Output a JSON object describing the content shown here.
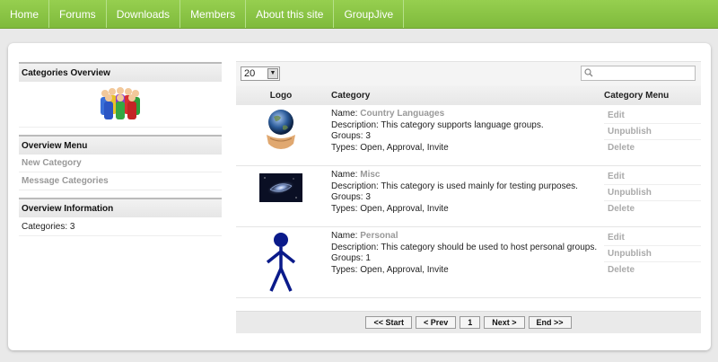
{
  "nav": {
    "items": [
      "Home",
      "Forums",
      "Downloads",
      "Members",
      "About this site",
      "GroupJive"
    ]
  },
  "sidebar": {
    "overview_title": "Categories Overview",
    "menu_title": "Overview Menu",
    "menu_items": [
      "New Category",
      "Message Categories"
    ],
    "info_title": "Overview Information",
    "info_text": "Categories: 3"
  },
  "toolbar": {
    "limit_value": "20",
    "search_placeholder": ""
  },
  "table": {
    "headers": {
      "logo": "Logo",
      "category": "Category",
      "menu": "Category Menu"
    },
    "name_label": "Name:",
    "rows": [
      {
        "logo": "globe-in-hands-icon",
        "name": "Country Languages",
        "description": "Description: This category supports language groups.",
        "groups": "Groups: 3",
        "types": "Types: Open, Approval, Invite"
      },
      {
        "logo": "galaxy-image",
        "name": "Misc",
        "description": "Description: This category is used mainly for testing purposes.",
        "groups": "Groups: 3",
        "types": "Types: Open, Approval, Invite"
      },
      {
        "logo": "stick-figure-icon",
        "name": "Personal",
        "description": "Description: This category should be used to host personal groups.",
        "groups": "Groups: 1",
        "types": "Types: Open, Approval, Invite"
      }
    ],
    "actions": [
      "Edit",
      "Unpublish",
      "Delete"
    ]
  },
  "pager": {
    "start": "<< Start",
    "prev": "< Prev",
    "page": "1",
    "next": "Next >",
    "end": "End >>"
  },
  "colors": {
    "nav": "#8bc34a",
    "link_gray": "#999999"
  }
}
